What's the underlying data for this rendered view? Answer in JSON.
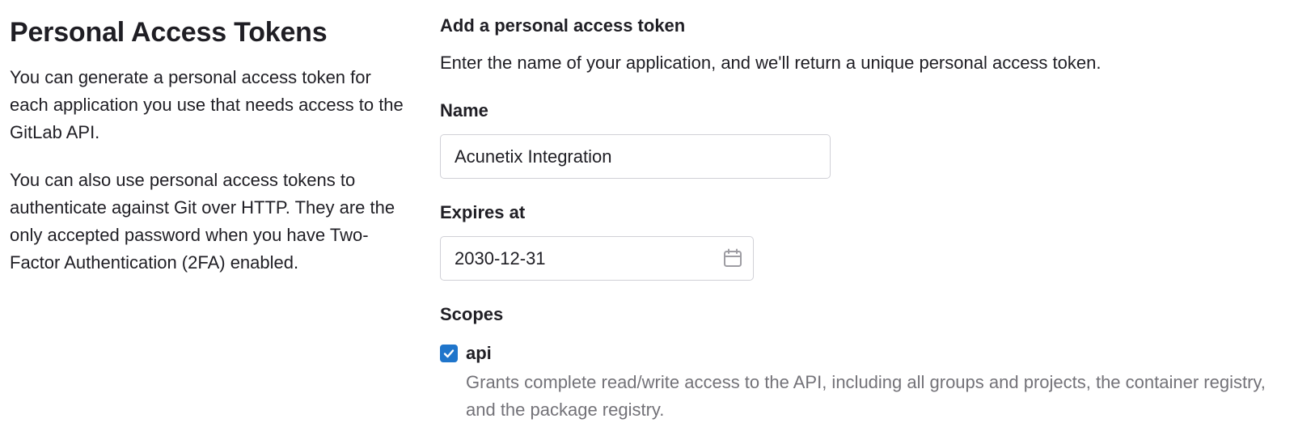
{
  "left": {
    "title": "Personal Access Tokens",
    "description_1": "You can generate a personal access token for each application you use that needs access to the GitLab API.",
    "description_2": "You can also use personal access tokens to authenticate against Git over HTTP. They are the only accepted password when you have Two-Factor Authentication (2FA) enabled."
  },
  "form": {
    "section_title": "Add a personal access token",
    "intro": "Enter the name of your application, and we'll return a unique personal access token.",
    "name_label": "Name",
    "name_value": "Acunetix Integration",
    "expires_label": "Expires at",
    "expires_value": "2030-12-31",
    "expires_icon": "calendar-icon",
    "scopes_label": "Scopes",
    "scopes": [
      {
        "name": "api",
        "checked": true,
        "description": "Grants complete read/write access to the API, including all groups and projects, the container registry, and the package registry."
      }
    ]
  },
  "colors": {
    "accent": "#1f75cb",
    "text": "#1f1e24",
    "muted_text": "#737278",
    "input_border": "#d0d0d6"
  }
}
